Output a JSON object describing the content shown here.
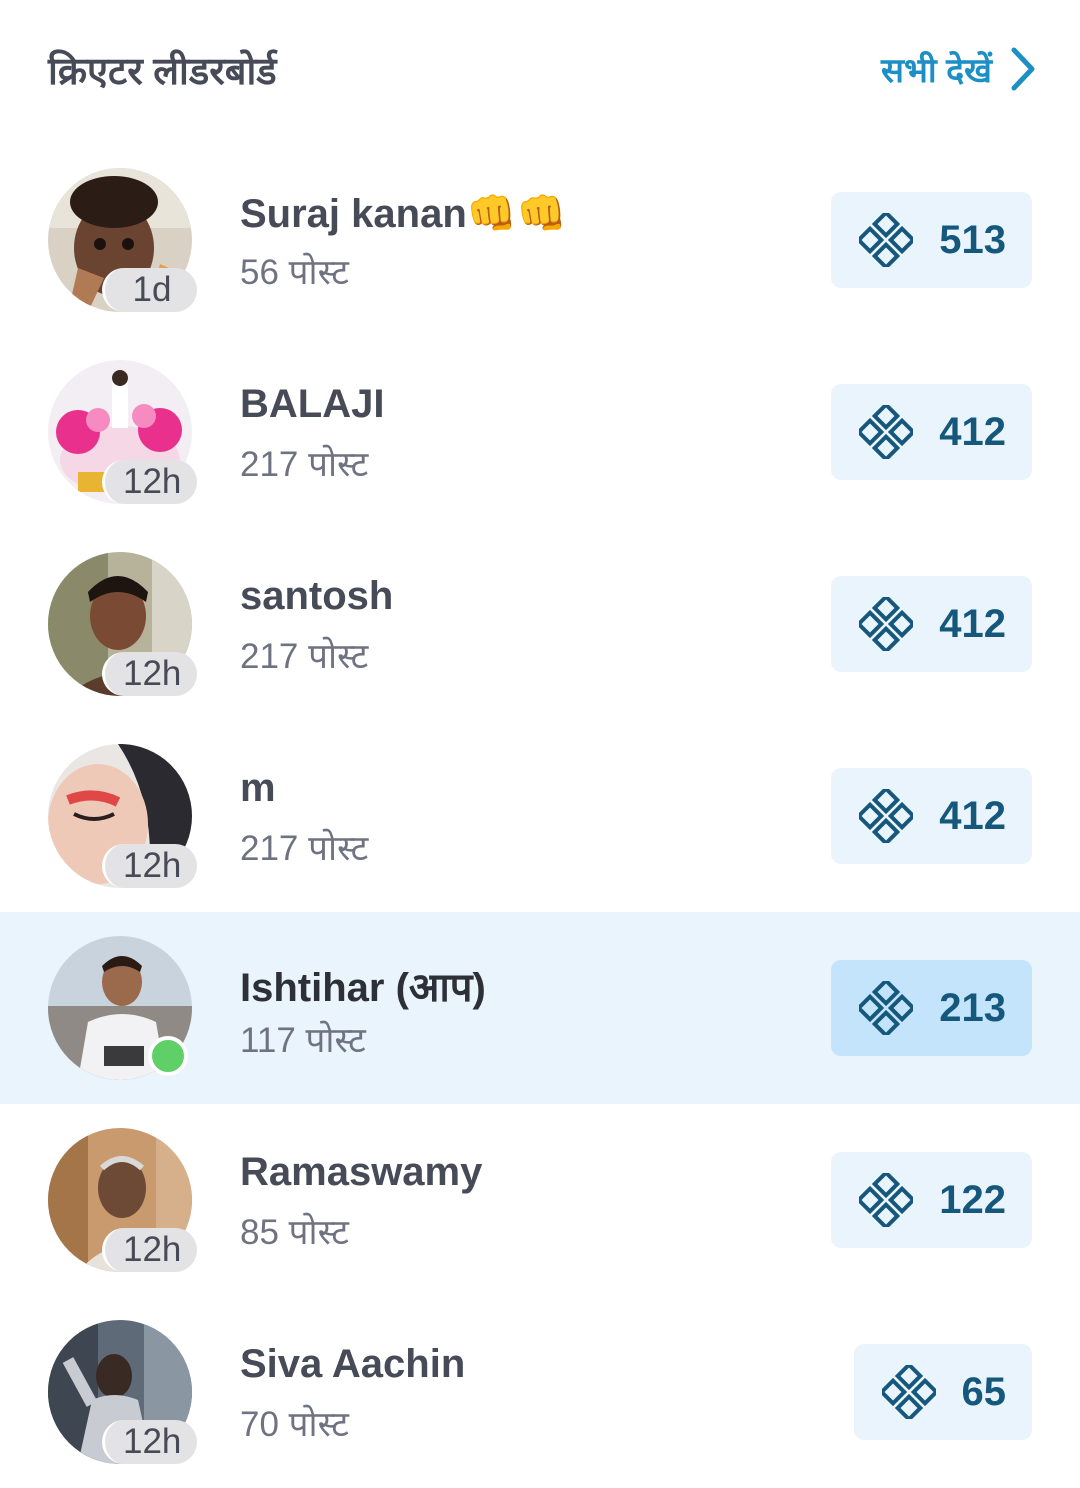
{
  "header": {
    "title": "क्रिएटर लीडरबोर्ड",
    "see_all_label": "सभी देखें"
  },
  "colors": {
    "accent": "#1d8fc4",
    "score_text": "#15587c",
    "highlight_row": "#eaf4fd",
    "online": "#5fcf68"
  },
  "leaderboard": [
    {
      "name": "Suraj kanan👊👊",
      "posts": "56 पोस्ट",
      "badge": "1d",
      "score": "513"
    },
    {
      "name": "BALAJI",
      "posts": "217 पोस्ट",
      "badge": "12h",
      "score": "412"
    },
    {
      "name": "santosh",
      "posts": "217 पोस्ट",
      "badge": "12h",
      "score": "412"
    },
    {
      "name": "m",
      "posts": "217 पोस्ट",
      "badge": "12h",
      "score": "412"
    },
    {
      "name": "Ishtihar (आप)",
      "posts": "117 पोस्ट",
      "badge": "",
      "online": true,
      "score": "213"
    },
    {
      "name": "Ramaswamy",
      "posts": "85 पोस्ट",
      "badge": "12h",
      "score": "122"
    },
    {
      "name": "Siva Aachin",
      "posts": "70 पोस्ट",
      "badge": "12h",
      "score": "65"
    }
  ]
}
